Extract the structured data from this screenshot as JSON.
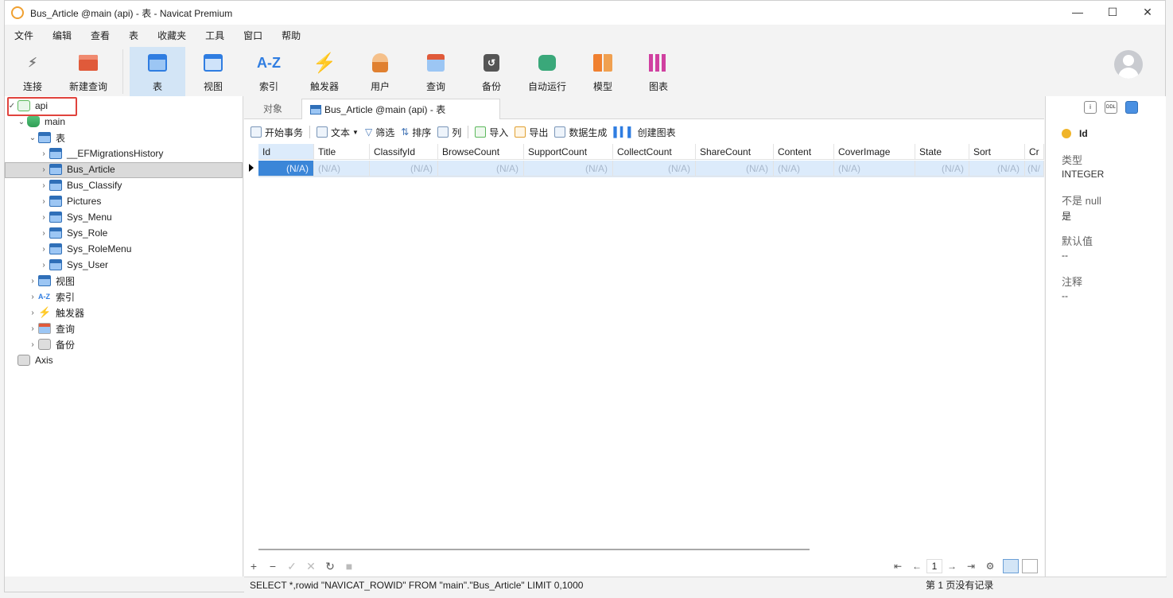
{
  "window": {
    "title": "Bus_Article @main (api) - 表 - Navicat Premium",
    "min": "—",
    "max": "☐",
    "close": "✕"
  },
  "menu": [
    "文件",
    "编辑",
    "查看",
    "表",
    "收藏夹",
    "工具",
    "窗口",
    "帮助"
  ],
  "toolbar": [
    {
      "label": "连接",
      "icon": "plug-icon",
      "color": "#777"
    },
    {
      "label": "新建查询",
      "icon": "new-query-icon",
      "color": "#e05a3a"
    },
    {
      "label": "表",
      "icon": "table-icon",
      "color": "#2f7de1"
    },
    {
      "label": "视图",
      "icon": "view-icon",
      "color": "#2f7de1"
    },
    {
      "label": "索引",
      "icon": "index-icon",
      "color": "#2f7de1"
    },
    {
      "label": "触发器",
      "icon": "trigger-icon",
      "color": "#f0b020"
    },
    {
      "label": "用户",
      "icon": "user-icon",
      "color": "#e08030"
    },
    {
      "label": "查询",
      "icon": "query-icon",
      "color": "#e05a3a"
    },
    {
      "label": "备份",
      "icon": "backup-icon",
      "color": "#555"
    },
    {
      "label": "自动运行",
      "icon": "robot-icon",
      "color": "#3aa87a"
    },
    {
      "label": "模型",
      "icon": "model-icon",
      "color": "#f08030"
    },
    {
      "label": "图表",
      "icon": "chart-icon",
      "color": "#d040a0"
    }
  ],
  "toolbar_icon_text": {
    "index": "A-Z"
  },
  "tree": {
    "connection": "api",
    "database": "main",
    "tables_label": "表",
    "tables": [
      "__EFMigrationsHistory",
      "Bus_Article",
      "Bus_Classify",
      "Pictures",
      "Sys_Menu",
      "Sys_Role",
      "Sys_RoleMenu",
      "Sys_User"
    ],
    "selected_table": "Bus_Article",
    "groups": [
      "视图",
      "索引",
      "触发器",
      "查询",
      "备份"
    ],
    "index_icon_text": "A-Z",
    "other_connection": "Axis"
  },
  "tabs": {
    "objects": "对象",
    "current": "Bus_Article @main (api) - 表"
  },
  "subtoolbar": [
    "开始事务",
    "文本",
    "筛选",
    "排序",
    "列",
    "导入",
    "导出",
    "数据生成",
    "创建图表"
  ],
  "grid": {
    "columns": [
      "Id",
      "Title",
      "ClassifyId",
      "BrowseCount",
      "SupportCount",
      "CollectCount",
      "ShareCount",
      "Content",
      "CoverImage",
      "State",
      "Sort",
      "Cr"
    ],
    "row": [
      "(N/A)",
      "(N/A)",
      "(N/A)",
      "(N/A)",
      "(N/A)",
      "(N/A)",
      "(N/A)",
      "(N/A)",
      "(N/A)",
      "(N/A)",
      "(N/A)",
      "(N/"
    ]
  },
  "bottom_buttons": [
    "+",
    "−",
    "✓",
    "✕",
    "↻",
    "■"
  ],
  "pager": {
    "first": "⇤",
    "prev": "←",
    "page": "1",
    "next": "→",
    "last": "⇥",
    "settings": "⚙"
  },
  "status": {
    "sql": "SELECT *,rowid \"NAVICAT_ROWID\" FROM \"main\".\"Bus_Article\" LIMIT 0,1000",
    "page_info": "第 1 页没有记录"
  },
  "properties": {
    "field": "Id",
    "type_label": "类型",
    "type_value": "INTEGER",
    "notnull_label": "不是 null",
    "notnull_value": "是",
    "default_label": "默认值",
    "default_value": "--",
    "comment_label": "注释",
    "comment_value": "--",
    "ddl_icon_text": "DDL"
  }
}
